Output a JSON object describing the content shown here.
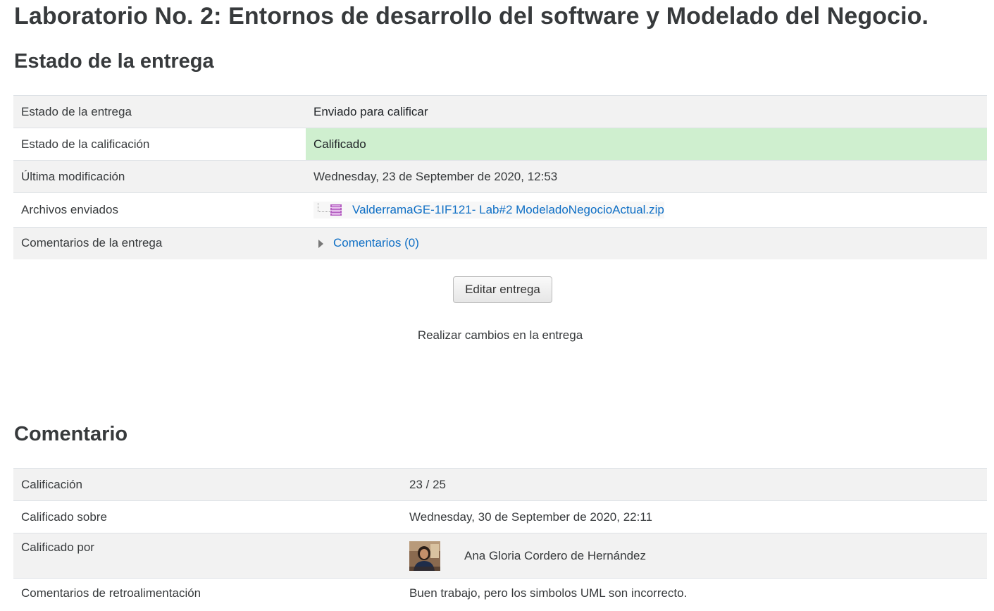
{
  "page": {
    "title": "Laboratorio No. 2: Entornos de desarrollo del software y Modelado del Negocio."
  },
  "submission_status": {
    "heading": "Estado de la entrega",
    "rows": [
      {
        "label": "Estado de la entrega",
        "value": "Enviado para calificar"
      },
      {
        "label": "Estado de la calificación",
        "value": "Calificado"
      },
      {
        "label": "Última modificación",
        "value": "Wednesday, 23 de September de 2020, 12:53"
      },
      {
        "label": "Archivos enviados",
        "value": "ValderramaGE-1IF121- Lab#2 ModeladoNegocioActual.zip"
      },
      {
        "label": "Comentarios de la entrega",
        "value": "Comentarios (0)"
      }
    ],
    "graded_highlight_color": "#cfefcf",
    "file_icon": "zip-archive-icon",
    "comments_toggle_icon": "caret-right-icon"
  },
  "actions": {
    "edit_button_label": "Editar entrega",
    "edit_help_text": "Realizar cambios en la entrega"
  },
  "feedback": {
    "heading": "Comentario",
    "rows": [
      {
        "label": "Calificación",
        "value": "23 / 25"
      },
      {
        "label": "Calificado sobre",
        "value": "Wednesday, 30 de September de 2020, 22:11"
      },
      {
        "label": "Calificado por",
        "value": "Ana Gloria Cordero de Hernández"
      },
      {
        "label": "Comentarios de retroalimentación",
        "value": "Buen trabajo, pero los simbolos UML son incorrecto."
      }
    ],
    "grader_avatar_icon": "user-avatar"
  },
  "colors": {
    "text": "#373a3c",
    "link": "#0f6fc5",
    "row_stripe": "#f2f2f2",
    "border": "#dee2e6"
  }
}
